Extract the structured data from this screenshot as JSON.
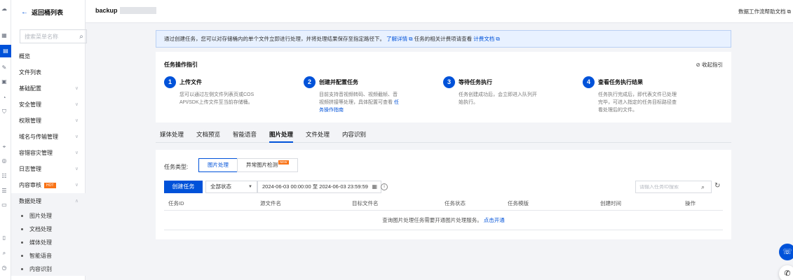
{
  "rail_icons": [
    "cloud-icon",
    "grid-icon",
    "bucket-icon",
    "pen-icon",
    "calendar-icon",
    "chart-icon",
    "shield-icon",
    "pin-icon",
    "compass-icon",
    "network-icon",
    "list-icon",
    "box-icon",
    "document-icon",
    "search-icon",
    "clock-icon"
  ],
  "sidebar": {
    "back_label": "返回桶列表",
    "search_placeholder": "搜索菜单名称",
    "items": [
      {
        "label": "概览"
      },
      {
        "label": "文件列表"
      },
      {
        "label": "基础配置"
      },
      {
        "label": "安全管理"
      },
      {
        "label": "权限管理"
      },
      {
        "label": "域名与传输管理"
      },
      {
        "label": "容错容灾管理"
      },
      {
        "label": "日志管理"
      },
      {
        "label": "内容审核",
        "badge": "HOT"
      },
      {
        "label": "数据处理"
      }
    ],
    "sub_items": [
      "图片处理",
      "文档处理",
      "媒体处理",
      "智能语音",
      "内容识别"
    ]
  },
  "header": {
    "bucket_name": "backup",
    "help_link": "数据工作流帮助文档"
  },
  "banner": {
    "text": "通过创建任务，您可以对存储桶内的单个文件立即进行处理，并将处理结果保存至指定路径下。",
    "link1": "了解详情",
    "text2": "任务的相关计费项请查看",
    "link2": "计费文档"
  },
  "guide": {
    "title": "任务操作指引",
    "collapse_label": "收起指引",
    "steps": [
      {
        "num": "1",
        "title": "上传文件",
        "desc": "您可以通过左侧文件列表页或COS API/SDK上传文件至当前存储桶。",
        "link": ""
      },
      {
        "num": "2",
        "title": "创建并配置任务",
        "desc": "目前支持音视频转码、视频截帧、音视频拼接等处理，具体配置可查看",
        "link": "任务操作指南"
      },
      {
        "num": "3",
        "title": "等待任务执行",
        "desc": "任务创建成功后，会立即进入队列开始执行。",
        "link": ""
      },
      {
        "num": "4",
        "title": "查看任务执行结果",
        "desc": "任务执行完成后，即代表文件已处理完毕，可进入指定的任务目标路径查看处理后的文件。",
        "link": ""
      }
    ]
  },
  "tabs": [
    "媒体处理",
    "文档预览",
    "智能语音",
    "图片处理",
    "文件处理",
    "内容识别"
  ],
  "active_tab": "图片处理",
  "task_panel": {
    "type_label": "任务类型:",
    "type_options": [
      {
        "label": "图片处理",
        "badge": ""
      },
      {
        "label": "异常图片检测",
        "badge": "NEW"
      }
    ],
    "create_button": "创建任务",
    "status_select": "全部状态",
    "date_range": "2024-06-03 00:00:00 至 2024-06-03 23:59:59",
    "search_placeholder": "请输入任务ID搜索",
    "columns": [
      "任务ID",
      "源文件名",
      "目标文件名",
      "任务状态",
      "任务模版",
      "创建时间",
      "操作"
    ],
    "empty_text": "查询图片处理任务需要开通图片处理服务。",
    "empty_link": "点击开通"
  }
}
